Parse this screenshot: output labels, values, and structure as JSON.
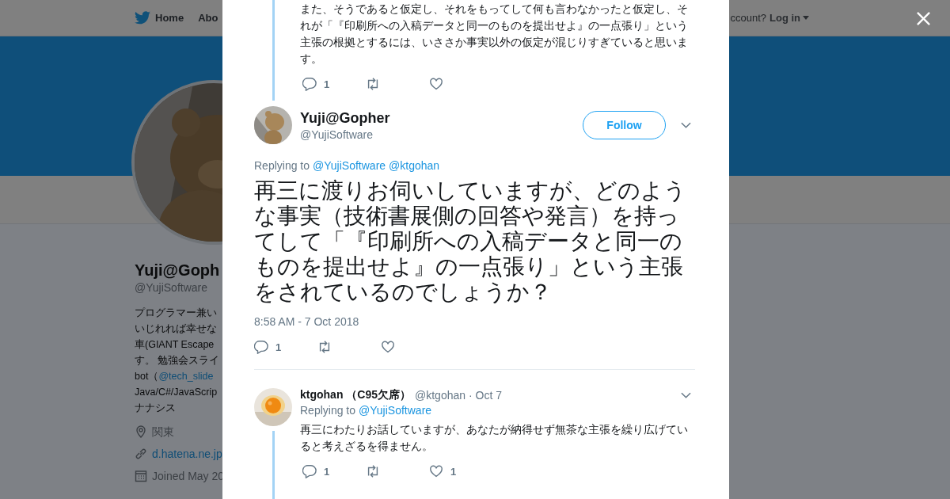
{
  "background": {
    "nav": {
      "items": [
        {
          "label": "Home",
          "kind": "home"
        },
        {
          "label": "Abo",
          "kind": "plain"
        }
      ],
      "account_prompt": "ccount?",
      "login": "Log in"
    },
    "profile": {
      "name": "Yuji@Goph",
      "handle": "@YujiSoftware",
      "bio": [
        {
          "text": "プログラマー兼い"
        },
        {
          "text": "いじれれば幸せな"
        },
        {
          "text": "車(GIANT Escape"
        },
        {
          "text": "す。 勉強会スライ"
        },
        {
          "text": "bot（",
          "link": "@tech_slide"
        },
        {
          "text": "Java/C#/JavaScrip"
        },
        {
          "text": "ナナシス"
        }
      ],
      "details": [
        {
          "kind": "location",
          "text": "関東"
        },
        {
          "kind": "link",
          "text": "d.hatena.ne.jp"
        },
        {
          "kind": "joined",
          "text": "Joined May 20"
        }
      ]
    }
  },
  "modal": {
    "tweets": [
      {
        "kind": "context",
        "text": "また、そうであると仮定し、それをもってして何も言わなかったと仮定し、それが「『印刷所への入稿データと同一のものを提出せよ』の一点張り」という主張の根拠とするには、いささか事実以外の仮定が混じりすぎていると思います。",
        "actions": {
          "replies": "1"
        }
      },
      {
        "kind": "focus",
        "name": "Yuji@Gopher",
        "handle": "@YujiSoftware",
        "follow": "Follow",
        "replying_label": "Replying to",
        "replying_to": [
          "@YujiSoftware",
          "@ktgohan"
        ],
        "text": "再三に渡りお伺いしていますが、どのような事実（技術書展側の回答や発言）を持ってして「『印刷所への入稿データと同一のものを提出せよ』の一点張り」という主張をされているのでしょうか？",
        "timestamp": "8:58 AM - 7 Oct 2018",
        "actions": {
          "replies": "1"
        }
      },
      {
        "kind": "reply",
        "name": "ktgohan",
        "name_suffix": "（C95欠席）",
        "meta": "@ktgohan · Oct 7",
        "replying_label": "Replying to",
        "replying_to": [
          "@YujiSoftware"
        ],
        "text": "再三にわたりお話していますが、あなたが納得せず無茶な主張を繰り広げていると考えざるを得ません。",
        "actions": {
          "replies": "1",
          "likes": "1"
        }
      }
    ]
  }
}
